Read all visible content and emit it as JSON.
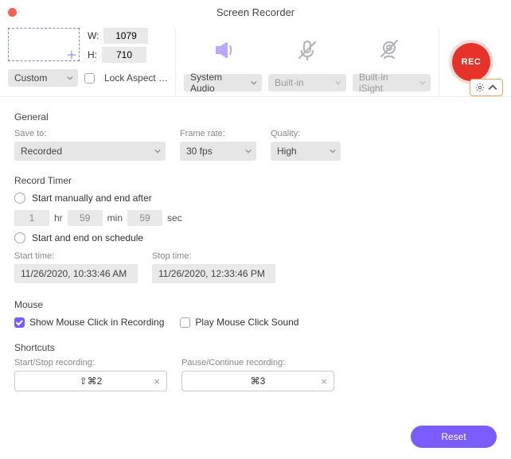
{
  "title": "Screen Recorder",
  "region": {
    "width": "1079",
    "height": "710",
    "w_label": "W:",
    "h_label": "H:",
    "preset": "Custom",
    "lock_label": "Lock Aspect R…",
    "lock_checked": false
  },
  "sources": {
    "system_audio": "System Audio",
    "mic": "Built-in",
    "camera": "Built-in iSight"
  },
  "rec_label": "REC",
  "general": {
    "heading": "General",
    "save_to_label": "Save to:",
    "save_to": "Recorded",
    "framerate_label": "Frame rate:",
    "framerate": "30 fps",
    "quality_label": "Quality:",
    "quality": "High"
  },
  "timer": {
    "heading": "Record Timer",
    "opt_manual": "Start manually and end after",
    "opt_schedule": "Start and end on schedule",
    "hr_val": "1",
    "min_val": "59",
    "sec_val": "59",
    "hr_unit": "hr",
    "min_unit": "min",
    "sec_unit": "sec",
    "start_label": "Start time:",
    "stop_label": "Stop time:",
    "start_time": "11/26/2020, 10:33:46 AM",
    "stop_time": "11/26/2020, 12:33:46 PM"
  },
  "mouse": {
    "heading": "Mouse",
    "show_clicks": "Show Mouse Click in Recording",
    "play_sound": "Play Mouse Click Sound",
    "show_checked": true,
    "sound_checked": false
  },
  "shortcuts": {
    "heading": "Shortcuts",
    "startstop_label": "Start/Stop recording:",
    "pause_label": "Pause/Continue recording:",
    "startstop_key": "⇧⌘2",
    "pause_key": "⌘3"
  },
  "reset_label": "Reset"
}
